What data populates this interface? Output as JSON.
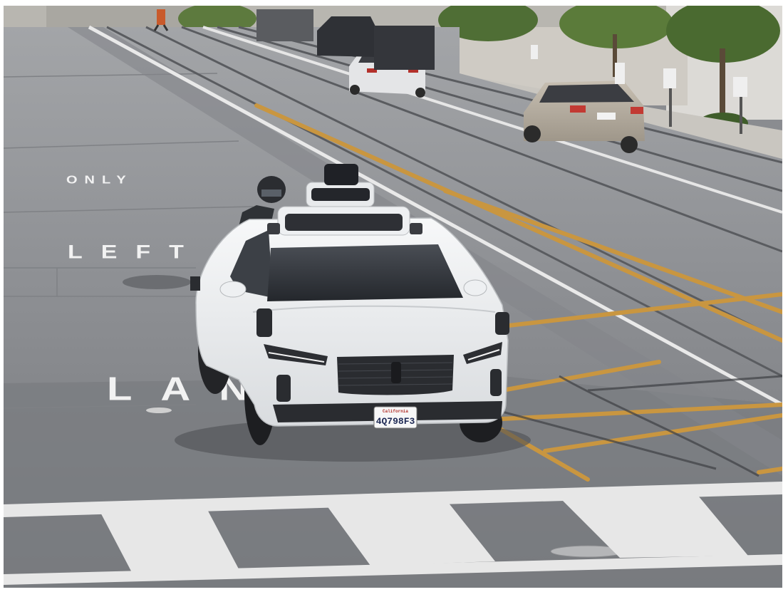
{
  "scene": {
    "road_markings": {
      "word_1": "ONLY",
      "word_2": "LEFT",
      "word_3": "LANE"
    },
    "vehicle": {
      "license_plate": "4Q798F3",
      "plate_state": "California"
    },
    "colors": {
      "asphalt": "#8f9296",
      "asphalt_dark": "#6f7276",
      "lane_paint": "#f2f2f2",
      "rail_stripe": "#c99640",
      "car_body": "#eef0f2",
      "sidewalk": "#c9c6c0"
    }
  }
}
